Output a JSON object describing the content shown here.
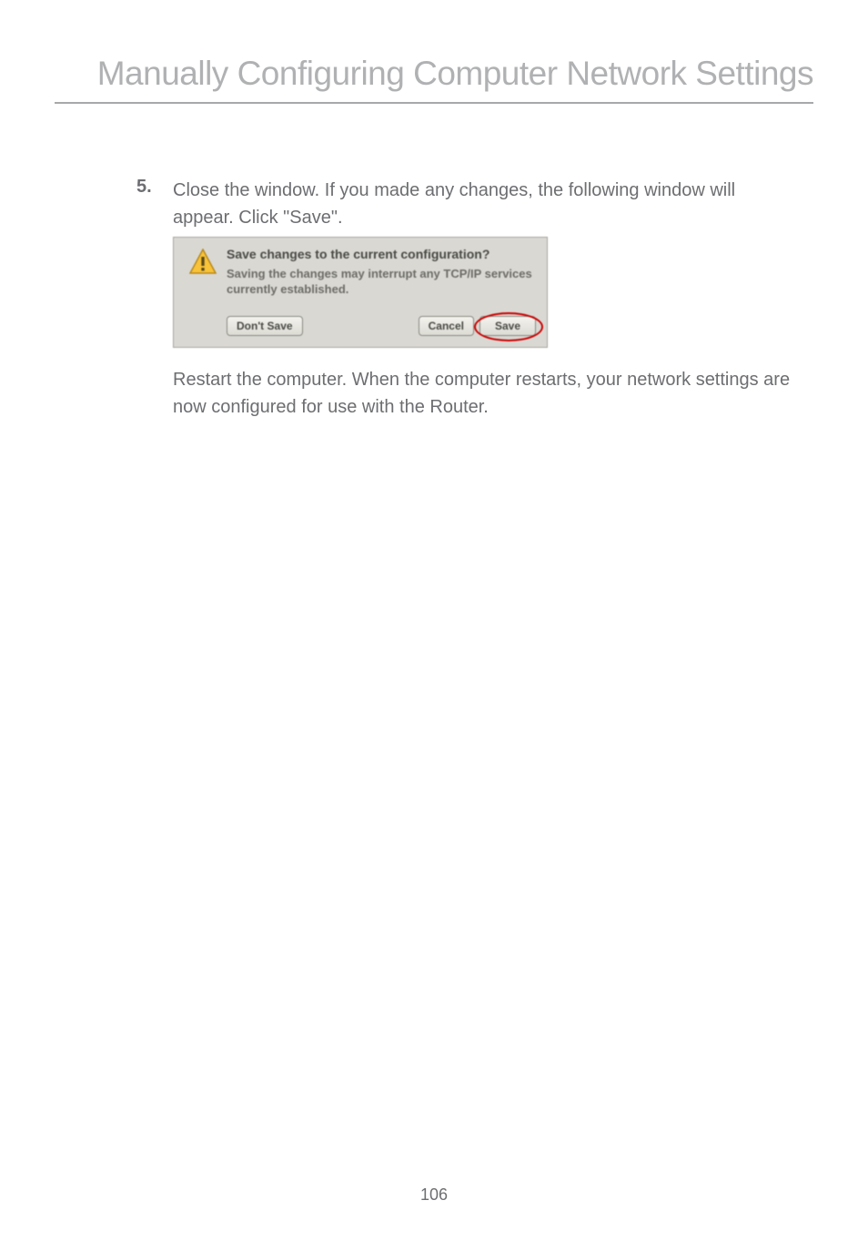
{
  "header": {
    "title": "Manually Configuring Computer Network Settings"
  },
  "step": {
    "number": "5.",
    "text": "Close the window. If you made any changes, the following window will appear. Click \"Save\"."
  },
  "dialog": {
    "title": "Save changes to the current configuration?",
    "message": "Saving the changes may interrupt any TCP/IP services currently established.",
    "buttons": {
      "dont_save": "Don't Save",
      "cancel": "Cancel",
      "save": "Save"
    },
    "icon_name": "warning-icon"
  },
  "follow_text": "Restart the computer. When the computer restarts, your network settings are now configured for use with the Router.",
  "page_number": "106"
}
